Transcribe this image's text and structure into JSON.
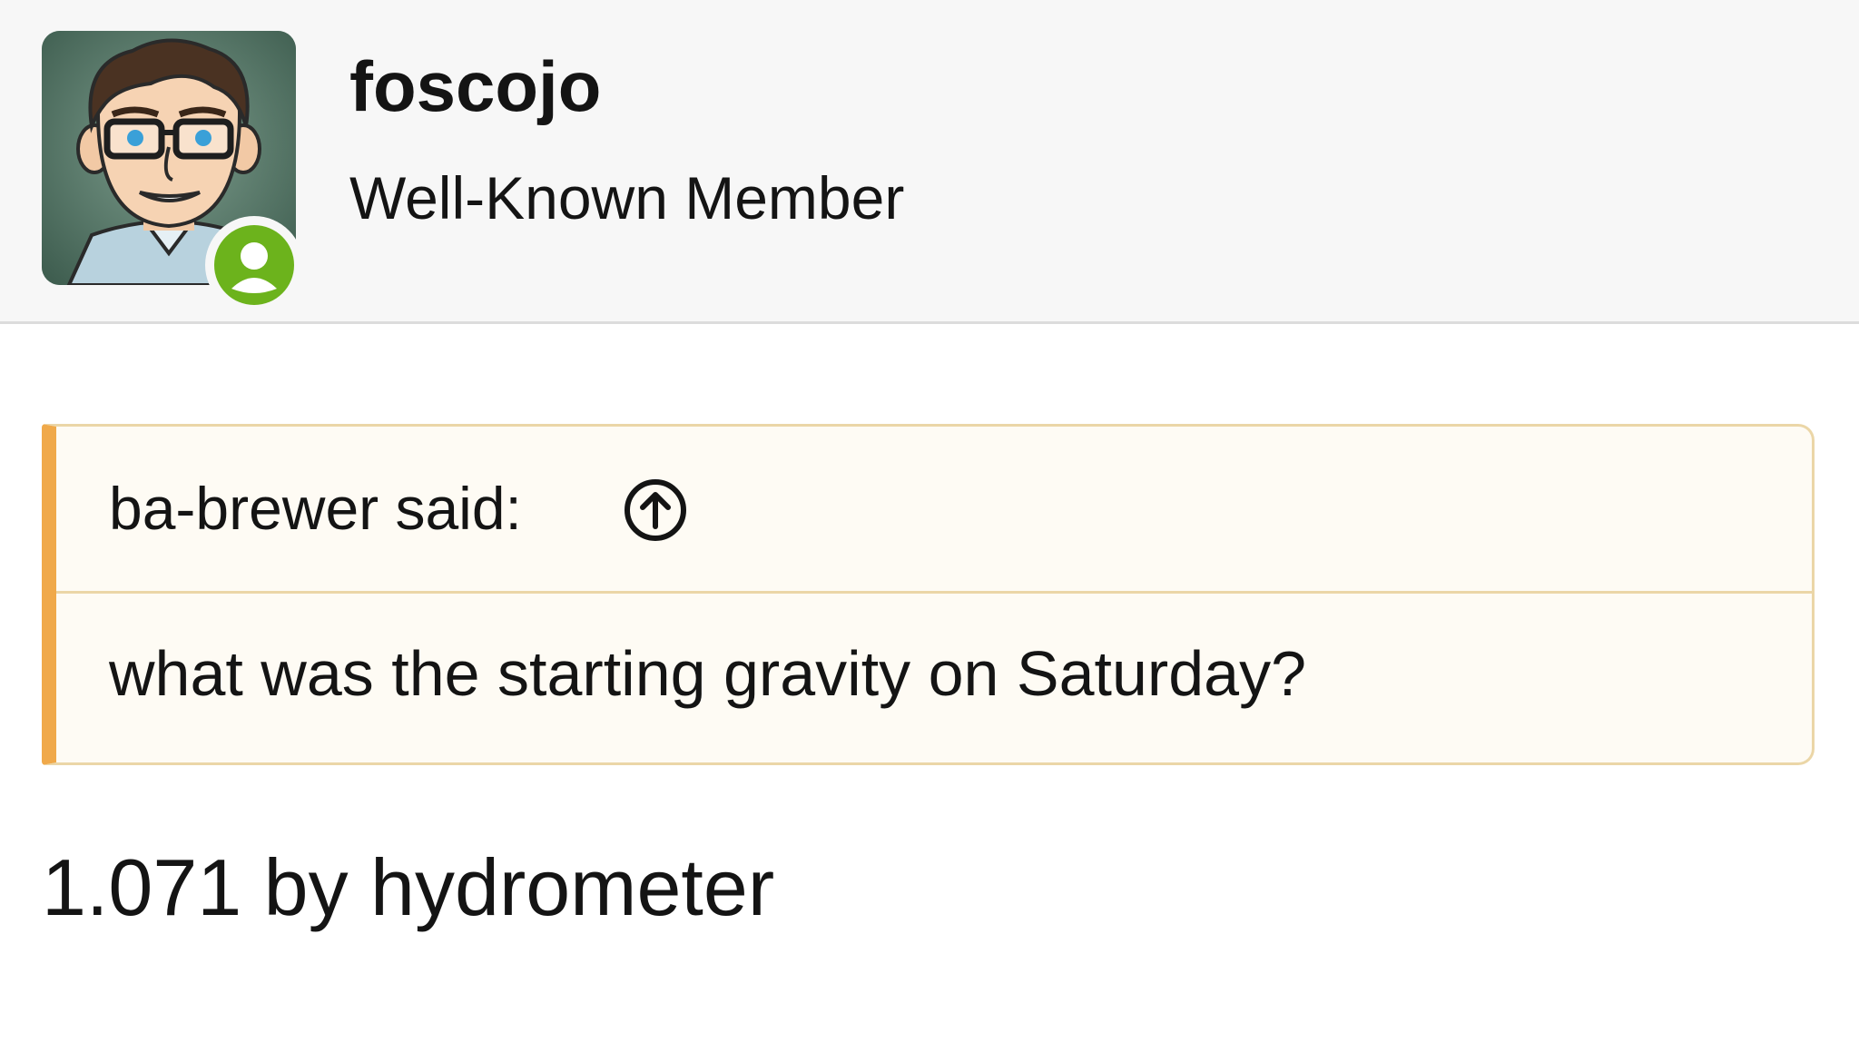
{
  "post": {
    "author": {
      "username": "foscojo",
      "title": "Well-Known Member",
      "avatar_icon": "avatar-cartoon-man-glasses",
      "status_icon": "online-user-icon",
      "status_color": "#6cb31c"
    },
    "quote": {
      "author_label": "ba-brewer said:",
      "jump_icon": "arrow-up-circle-icon",
      "text": "what was the starting gravity on Saturday?",
      "accent_color": "#f0a94a",
      "border_color": "#ebd6a7",
      "background_color": "#fefbf4"
    },
    "reply_text": "1.071 by hydrometer"
  }
}
